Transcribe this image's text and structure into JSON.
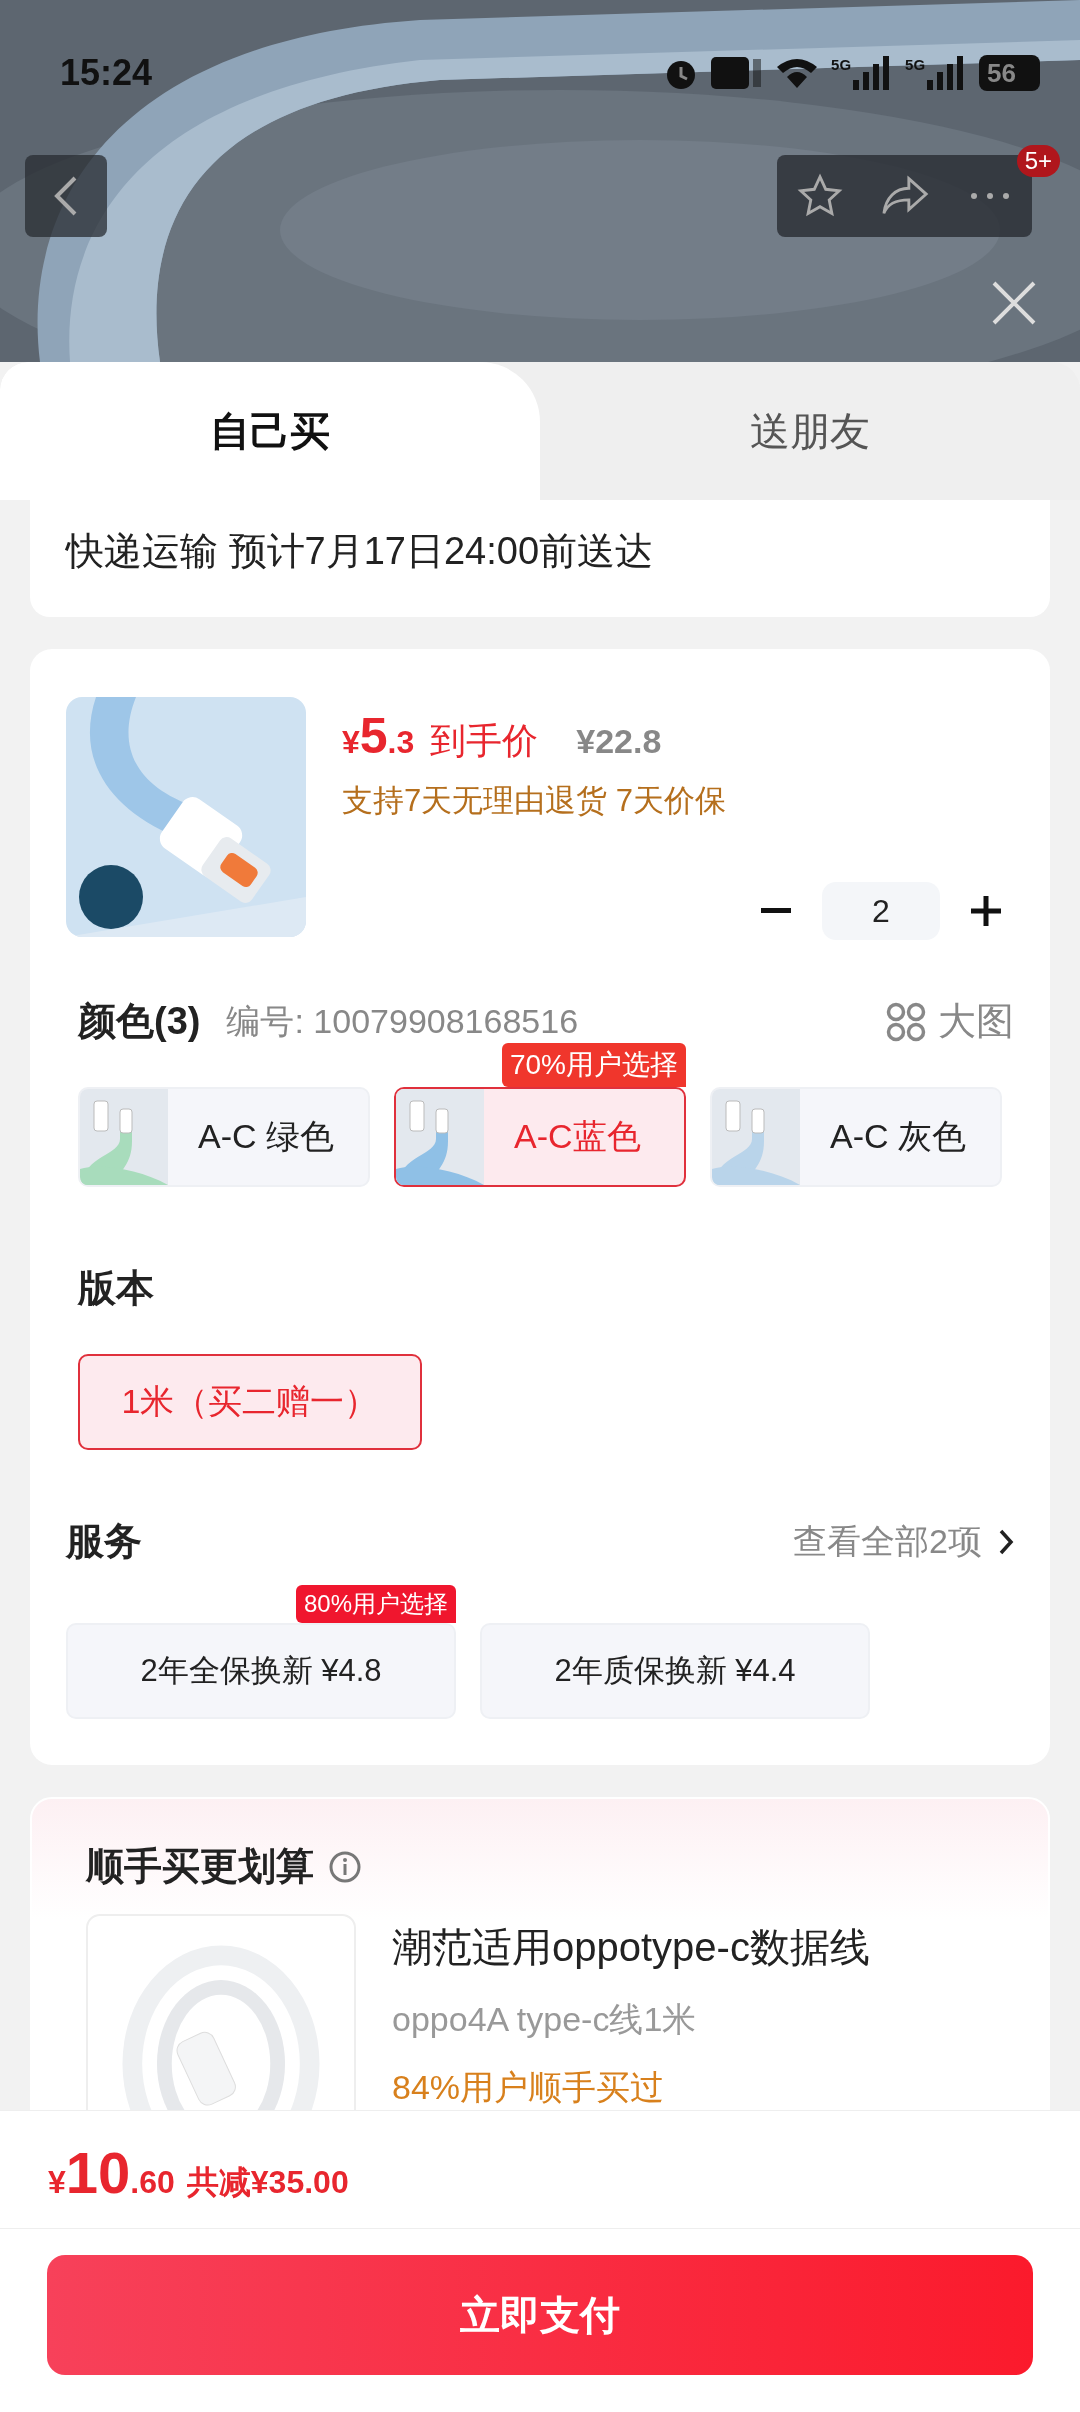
{
  "status_bar": {
    "time": "15:24",
    "signals": [
      {
        "label": "5G"
      },
      {
        "label": "5G"
      }
    ],
    "battery": "56"
  },
  "nav": {
    "badge": "5+"
  },
  "tabs": [
    {
      "label": "自己买",
      "selected": true
    },
    {
      "label": "送朋友",
      "selected": false
    }
  ],
  "delivery": "快递运输 预计7月17日24:00前送达",
  "product": {
    "currency": "¥",
    "price_int": "5",
    "price_dec": ".3",
    "price_label": "到手价",
    "original_price": "¥22.8",
    "guarantee": "支持7天无理由退货 7天价保",
    "quantity": "2"
  },
  "color_section": {
    "title": "颜色(3)",
    "code": "编号: 10079908168516",
    "big_image": "大图",
    "options": [
      {
        "label": "A-C 绿色",
        "selected": false,
        "color": "#a8dcbc"
      },
      {
        "label": "A-C蓝色",
        "selected": true,
        "color": "#8fc0e6",
        "badge": "70%用户选择"
      },
      {
        "label": "A-C 灰色",
        "selected": false,
        "color": "#b9d4ea"
      }
    ]
  },
  "version_section": {
    "title": "版本",
    "options": [
      {
        "label": "1米（买二赠一）",
        "selected": true
      }
    ]
  },
  "service_section": {
    "title": "服务",
    "view_all": "查看全部2项",
    "options": [
      {
        "label": "2年全保换新  ¥4.8",
        "selected": false,
        "badge": "80%用户选择"
      },
      {
        "label": "2年质保换新  ¥4.4",
        "selected": false
      }
    ]
  },
  "recommend": {
    "title": "顺手买更划算",
    "item": {
      "name": "潮范适用oppotype-c数据线",
      "spec": "oppo4A type-c线1米",
      "note": "84%用户顺手买过"
    }
  },
  "footer": {
    "currency": "¥",
    "total_int": "10",
    "total_dec": ".60",
    "discount": "共减¥35.00",
    "pay_button": "立即支付"
  }
}
